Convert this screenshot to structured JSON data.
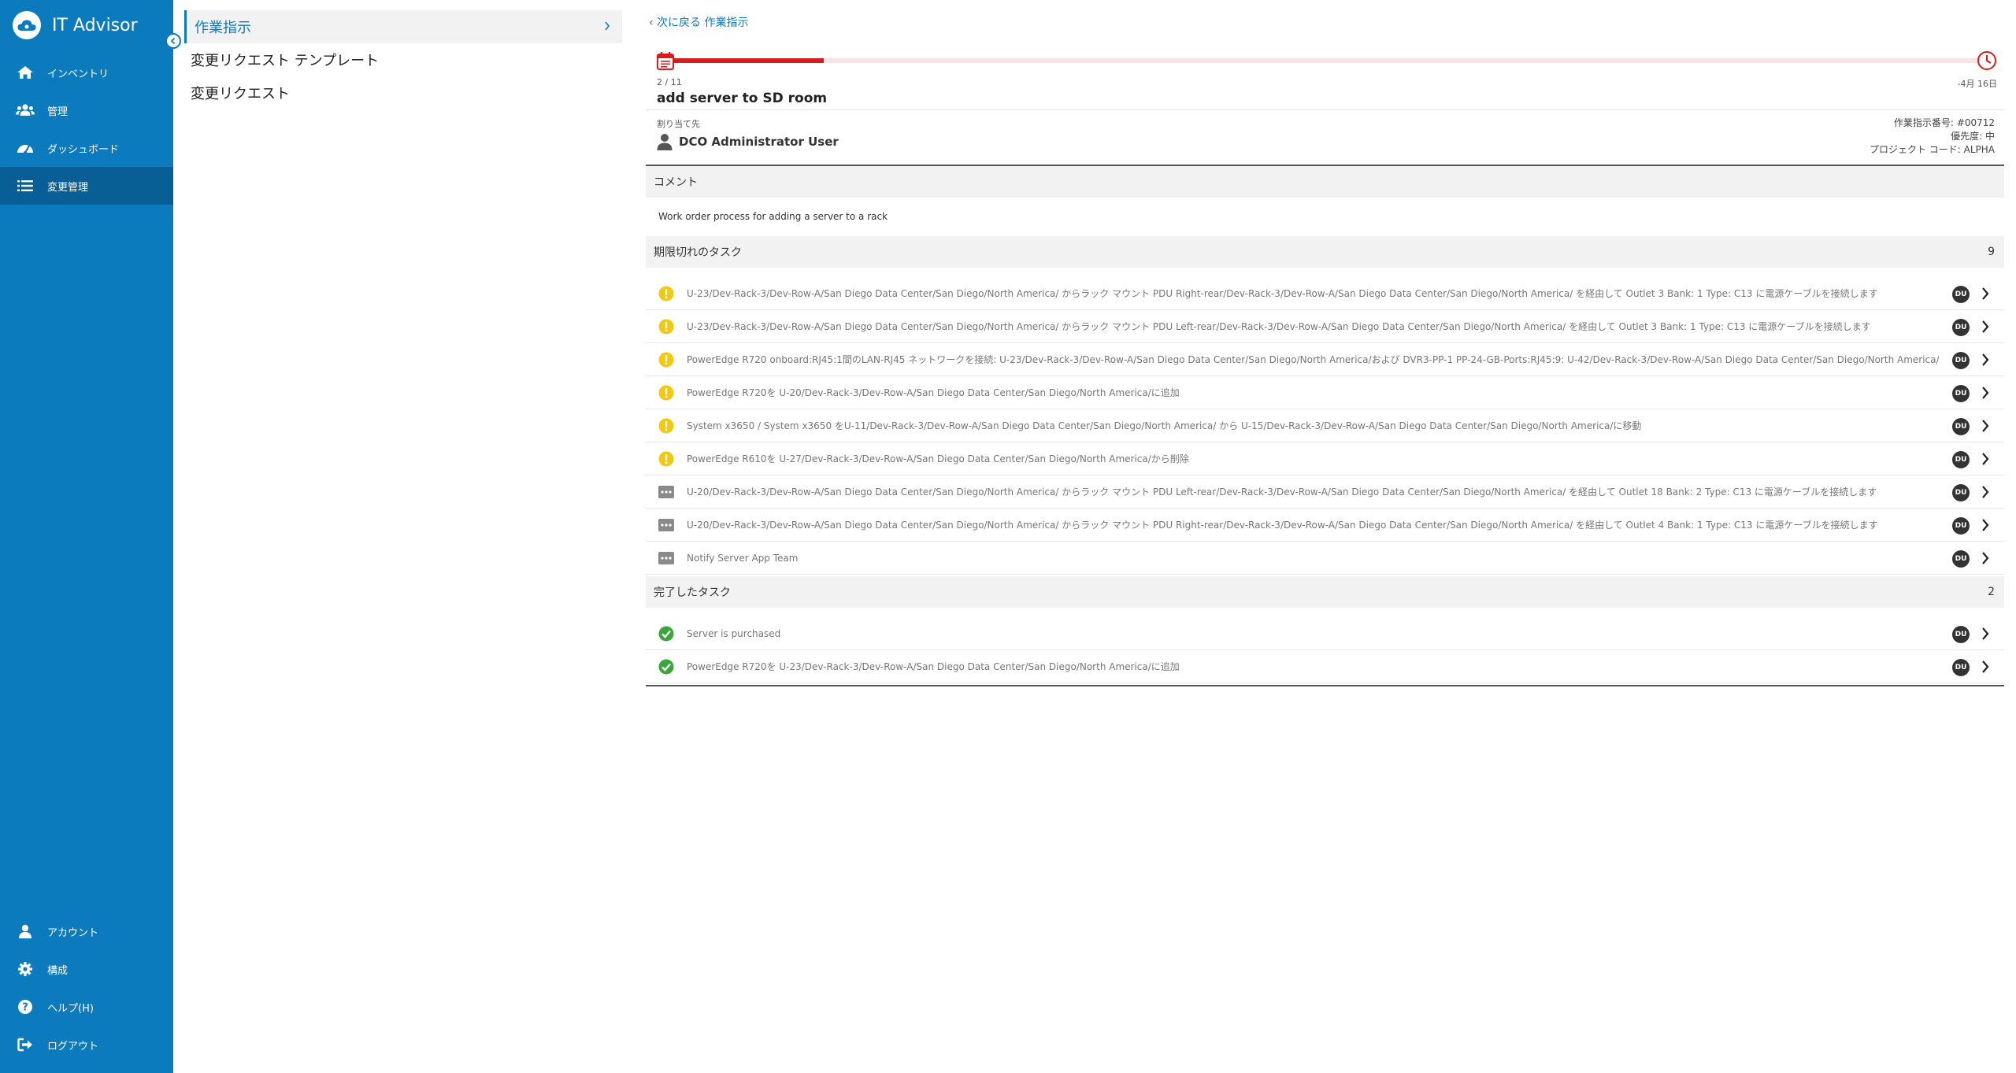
{
  "sidebar": {
    "brand": "IT Advisor",
    "items": [
      {
        "label": "インベントリ",
        "icon": "home-icon"
      },
      {
        "label": "管理",
        "icon": "users-icon"
      },
      {
        "label": "ダッシュボード",
        "icon": "dashboard-gauge-icon"
      },
      {
        "label": "変更管理",
        "icon": "list-icon",
        "active": true
      }
    ],
    "bottom_items": [
      {
        "label": "アカウント",
        "icon": "user-icon"
      },
      {
        "label": "構成",
        "icon": "gear-icon"
      },
      {
        "label": "ヘルプ(H)",
        "icon": "help-icon"
      },
      {
        "label": "ログアウト",
        "icon": "logout-icon"
      }
    ]
  },
  "midpanel": {
    "items": [
      {
        "label": "作業指示",
        "active": true
      },
      {
        "label": "変更リクエスト テンプレート"
      },
      {
        "label": "変更リクエスト"
      }
    ]
  },
  "main": {
    "breadcrumb": "‹ 次に戻る 作業指示",
    "progress": {
      "current": 2,
      "total": 11,
      "label": "2 / 11",
      "due": "-4月 16日",
      "fraction": 0.118
    },
    "title": "add server to SD room",
    "assigned_label": "割り当て先",
    "assignee": "DCO Administrator User",
    "meta": {
      "wo_number": "作業指示番号: #00712",
      "priority": "優先度: 中",
      "project_code": "プロジェクト コード: ALPHA"
    },
    "comment_header": "コメント",
    "comment_text": "Work order process for adding a server to a rack",
    "overdue_header": "期限切れのタスク",
    "overdue_count": "9",
    "overdue_tasks": [
      {
        "status": "warning",
        "text": "U-23/Dev-Rack-3/Dev-Row-A/San Diego Data Center/San Diego/North America/ からラック マウント PDU Right-rear/Dev-Rack-3/Dev-Row-A/San Diego Data Center/San Diego/North America/ を経由して Outlet 3 Bank: 1 Type: C13 に電源ケーブルを接続します",
        "badge": "DU"
      },
      {
        "status": "warning",
        "text": "U-23/Dev-Rack-3/Dev-Row-A/San Diego Data Center/San Diego/North America/ からラック マウント PDU Left-rear/Dev-Rack-3/Dev-Row-A/San Diego Data Center/San Diego/North America/ を経由して Outlet 3 Bank: 1 Type: C13 に電源ケーブルを接続します",
        "badge": "DU"
      },
      {
        "status": "warning",
        "text": "PowerEdge R720 onboard:RJ45:1間のLAN-RJ45 ネットワークを接続: U-23/Dev-Rack-3/Dev-Row-A/San Diego Data Center/San Diego/North America/および DVR3-PP-1 PP-24-GB-Ports:RJ45:9: U-42/Dev-Rack-3/Dev-Row-A/San Diego Data Center/San Diego/North America/",
        "badge": "DU"
      },
      {
        "status": "warning",
        "text": "PowerEdge R720を U-20/Dev-Rack-3/Dev-Row-A/San Diego Data Center/San Diego/North America/に追加",
        "badge": "DU"
      },
      {
        "status": "warning",
        "text": "System x3650 / System x3650 をU-11/Dev-Rack-3/Dev-Row-A/San Diego Data Center/San Diego/North America/ から U-15/Dev-Rack-3/Dev-Row-A/San Diego Data Center/San Diego/North America/に移動",
        "badge": "DU"
      },
      {
        "status": "warning",
        "text": "PowerEdge R610を U-27/Dev-Rack-3/Dev-Row-A/San Diego Data Center/San Diego/North America/から削除",
        "badge": "DU"
      },
      {
        "status": "pending",
        "text": "U-20/Dev-Rack-3/Dev-Row-A/San Diego Data Center/San Diego/North America/ からラック マウント PDU Left-rear/Dev-Rack-3/Dev-Row-A/San Diego Data Center/San Diego/North America/ を経由して Outlet 18 Bank: 2 Type: C13 に電源ケーブルを接続します",
        "badge": "DU"
      },
      {
        "status": "pending",
        "text": "U-20/Dev-Rack-3/Dev-Row-A/San Diego Data Center/San Diego/North America/ からラック マウント PDU Right-rear/Dev-Rack-3/Dev-Row-A/San Diego Data Center/San Diego/North America/ を経由して Outlet 4 Bank: 1 Type: C13 に電源ケーブルを接続します",
        "badge": "DU"
      },
      {
        "status": "pending",
        "text": "Notify Server App Team",
        "badge": "DU"
      }
    ],
    "completed_header": "完了したタスク",
    "completed_count": "2",
    "completed_tasks": [
      {
        "status": "done",
        "text": "Server is purchased",
        "badge": "DU"
      },
      {
        "status": "done",
        "text": "PowerEdge R720を U-23/Dev-Rack-3/Dev-Row-A/San Diego Data Center/San Diego/North America/に追加",
        "badge": "DU"
      }
    ]
  },
  "colors": {
    "sidebar": "#0b7bbd",
    "sidebar_active": "#075f95",
    "progress": "#d81c1c",
    "warning": "#f2c811",
    "done": "#3aa53a",
    "pending": "#8a8a8a"
  }
}
